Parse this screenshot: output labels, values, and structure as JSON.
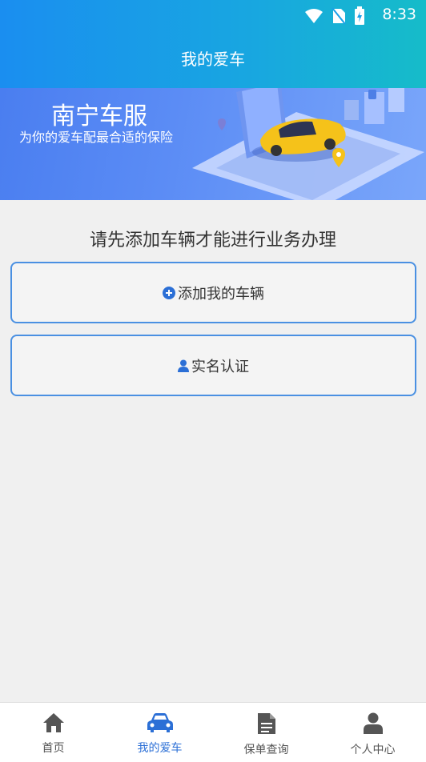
{
  "status": {
    "time": "8:33"
  },
  "header": {
    "title": "我的爱车"
  },
  "banner": {
    "title": "南宁车服",
    "subtitle": "为你的爱车配最合适的保险"
  },
  "main": {
    "prompt": "请先添加车辆才能进行业务办理",
    "add_vehicle_label": "添加我的车辆",
    "verify_label": "实名认证"
  },
  "tabs": [
    {
      "label": "首页",
      "icon": "home-icon"
    },
    {
      "label": "我的爱车",
      "icon": "car-icon",
      "active": true
    },
    {
      "label": "保单查询",
      "icon": "document-icon"
    },
    {
      "label": "个人中心",
      "icon": "user-icon"
    }
  ],
  "colors": {
    "accent": "#4a90e2",
    "active_tab": "#2b6fd6",
    "header_start": "#1a8ef0",
    "header_end": "#16bcc9"
  }
}
